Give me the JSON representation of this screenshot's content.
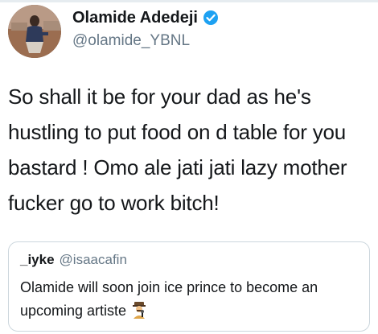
{
  "author": {
    "display_name": "Olamide Adedeji",
    "handle": "@olamide_YBNL",
    "verified": true,
    "avatar_icon": "profile-photo",
    "verified_icon": "verified-badge-icon",
    "verified_color": "#1da1f2"
  },
  "tweet": {
    "text": "So shall it be for your dad as he's\nhustling to put food on d table for you\nbastard ! Omo ale jati jati lazy mother\nfucker go to work bitch!"
  },
  "quoted_tweet": {
    "display_name": "_iyke",
    "handle": "@isaacafin",
    "text": "Olamide will soon join ice prince to become an upcoming artiste",
    "emoji_icon": "singer-emoji-icon"
  },
  "colors": {
    "text": "#14171a",
    "secondary": "#657786",
    "border": "#ccd6dd"
  }
}
